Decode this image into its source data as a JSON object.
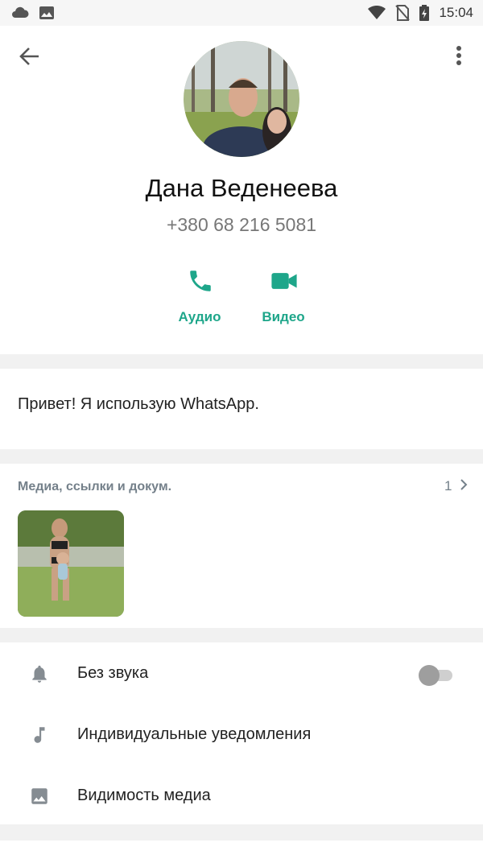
{
  "status_bar": {
    "time": "15:04",
    "icons": [
      "cloud-icon",
      "image-icon",
      "wifi-icon",
      "no-sim-icon",
      "battery-charging-icon"
    ]
  },
  "header": {
    "back_icon": "arrow-left-icon",
    "menu_icon": "more-vertical-icon"
  },
  "profile": {
    "name": "Дана Веденеева",
    "phone": "+380 68 216 5081",
    "actions": [
      {
        "label": "Аудио",
        "icon": "phone-icon"
      },
      {
        "label": "Видео",
        "icon": "videocam-icon"
      }
    ]
  },
  "about": {
    "text": "Привет! Я использую WhatsApp."
  },
  "media": {
    "title": "Медиа, ссылки и докум.",
    "count": "1"
  },
  "settings": [
    {
      "label": "Без звука",
      "icon": "bell-icon",
      "toggle": false
    },
    {
      "label": "Индивидуальные уведомления",
      "icon": "music-note-icon"
    },
    {
      "label": "Видимость медиа",
      "icon": "image-icon"
    }
  ],
  "colors": {
    "accent": "#1ea68a",
    "icon_gray": "#858c92",
    "muted_text": "#777777",
    "background": "#f1f1f1"
  }
}
